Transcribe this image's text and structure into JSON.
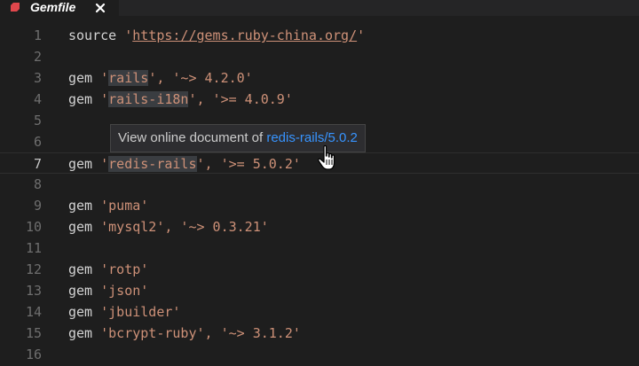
{
  "tab": {
    "label": "Gemfile",
    "close_label": "×",
    "icon": "ruby-gem-icon",
    "icon_color": "#e0474c"
  },
  "editor": {
    "lines": [
      {
        "number": "1",
        "tokens": [
          {
            "t": "source ",
            "c": "kw"
          },
          {
            "t": "'",
            "c": "q"
          },
          {
            "t": "https://gems.ruby-china.org/",
            "c": "url"
          },
          {
            "t": "'",
            "c": "q"
          }
        ]
      },
      {
        "number": "2",
        "tokens": []
      },
      {
        "number": "3",
        "tokens": [
          {
            "t": "gem ",
            "c": "kw"
          },
          {
            "t": "'",
            "c": "q"
          },
          {
            "t": "rails",
            "c": "str hl"
          },
          {
            "t": "', '~> 4.2.0'",
            "c": "str"
          }
        ]
      },
      {
        "number": "4",
        "tokens": [
          {
            "t": "gem ",
            "c": "kw"
          },
          {
            "t": "'",
            "c": "q"
          },
          {
            "t": "rails-i18n",
            "c": "str hl"
          },
          {
            "t": "', '>= 4.0.9'",
            "c": "str"
          }
        ]
      },
      {
        "number": "5",
        "tokens": []
      },
      {
        "number": "6",
        "tokens": []
      },
      {
        "number": "7",
        "tokens": [
          {
            "t": "gem ",
            "c": "kw"
          },
          {
            "t": "'",
            "c": "q"
          },
          {
            "t": "redis-rails",
            "c": "str hl"
          },
          {
            "t": "', '>= 5.0.2'",
            "c": "str"
          }
        ],
        "current": true
      },
      {
        "number": "8",
        "tokens": []
      },
      {
        "number": "9",
        "tokens": [
          {
            "t": "gem ",
            "c": "kw"
          },
          {
            "t": "'puma'",
            "c": "str"
          }
        ]
      },
      {
        "number": "10",
        "tokens": [
          {
            "t": "gem ",
            "c": "kw"
          },
          {
            "t": "'mysql2', '~> 0.3.21'",
            "c": "str"
          }
        ]
      },
      {
        "number": "11",
        "tokens": []
      },
      {
        "number": "12",
        "tokens": [
          {
            "t": "gem ",
            "c": "kw"
          },
          {
            "t": "'rotp'",
            "c": "str"
          }
        ]
      },
      {
        "number": "13",
        "tokens": [
          {
            "t": "gem ",
            "c": "kw"
          },
          {
            "t": "'json'",
            "c": "str"
          }
        ]
      },
      {
        "number": "14",
        "tokens": [
          {
            "t": "gem ",
            "c": "kw"
          },
          {
            "t": "'jbuilder'",
            "c": "str"
          }
        ]
      },
      {
        "number": "15",
        "tokens": [
          {
            "t": "gem ",
            "c": "kw"
          },
          {
            "t": "'bcrypt-ruby', '~> 3.1.2'",
            "c": "str"
          }
        ]
      },
      {
        "number": "16",
        "tokens": []
      }
    ]
  },
  "tooltip": {
    "prefix": "View online document of ",
    "link": "redis-rails/5.0.2"
  },
  "colors": {
    "background": "#1e1e1e",
    "string": "#ce9178",
    "link": "#3794ff"
  }
}
